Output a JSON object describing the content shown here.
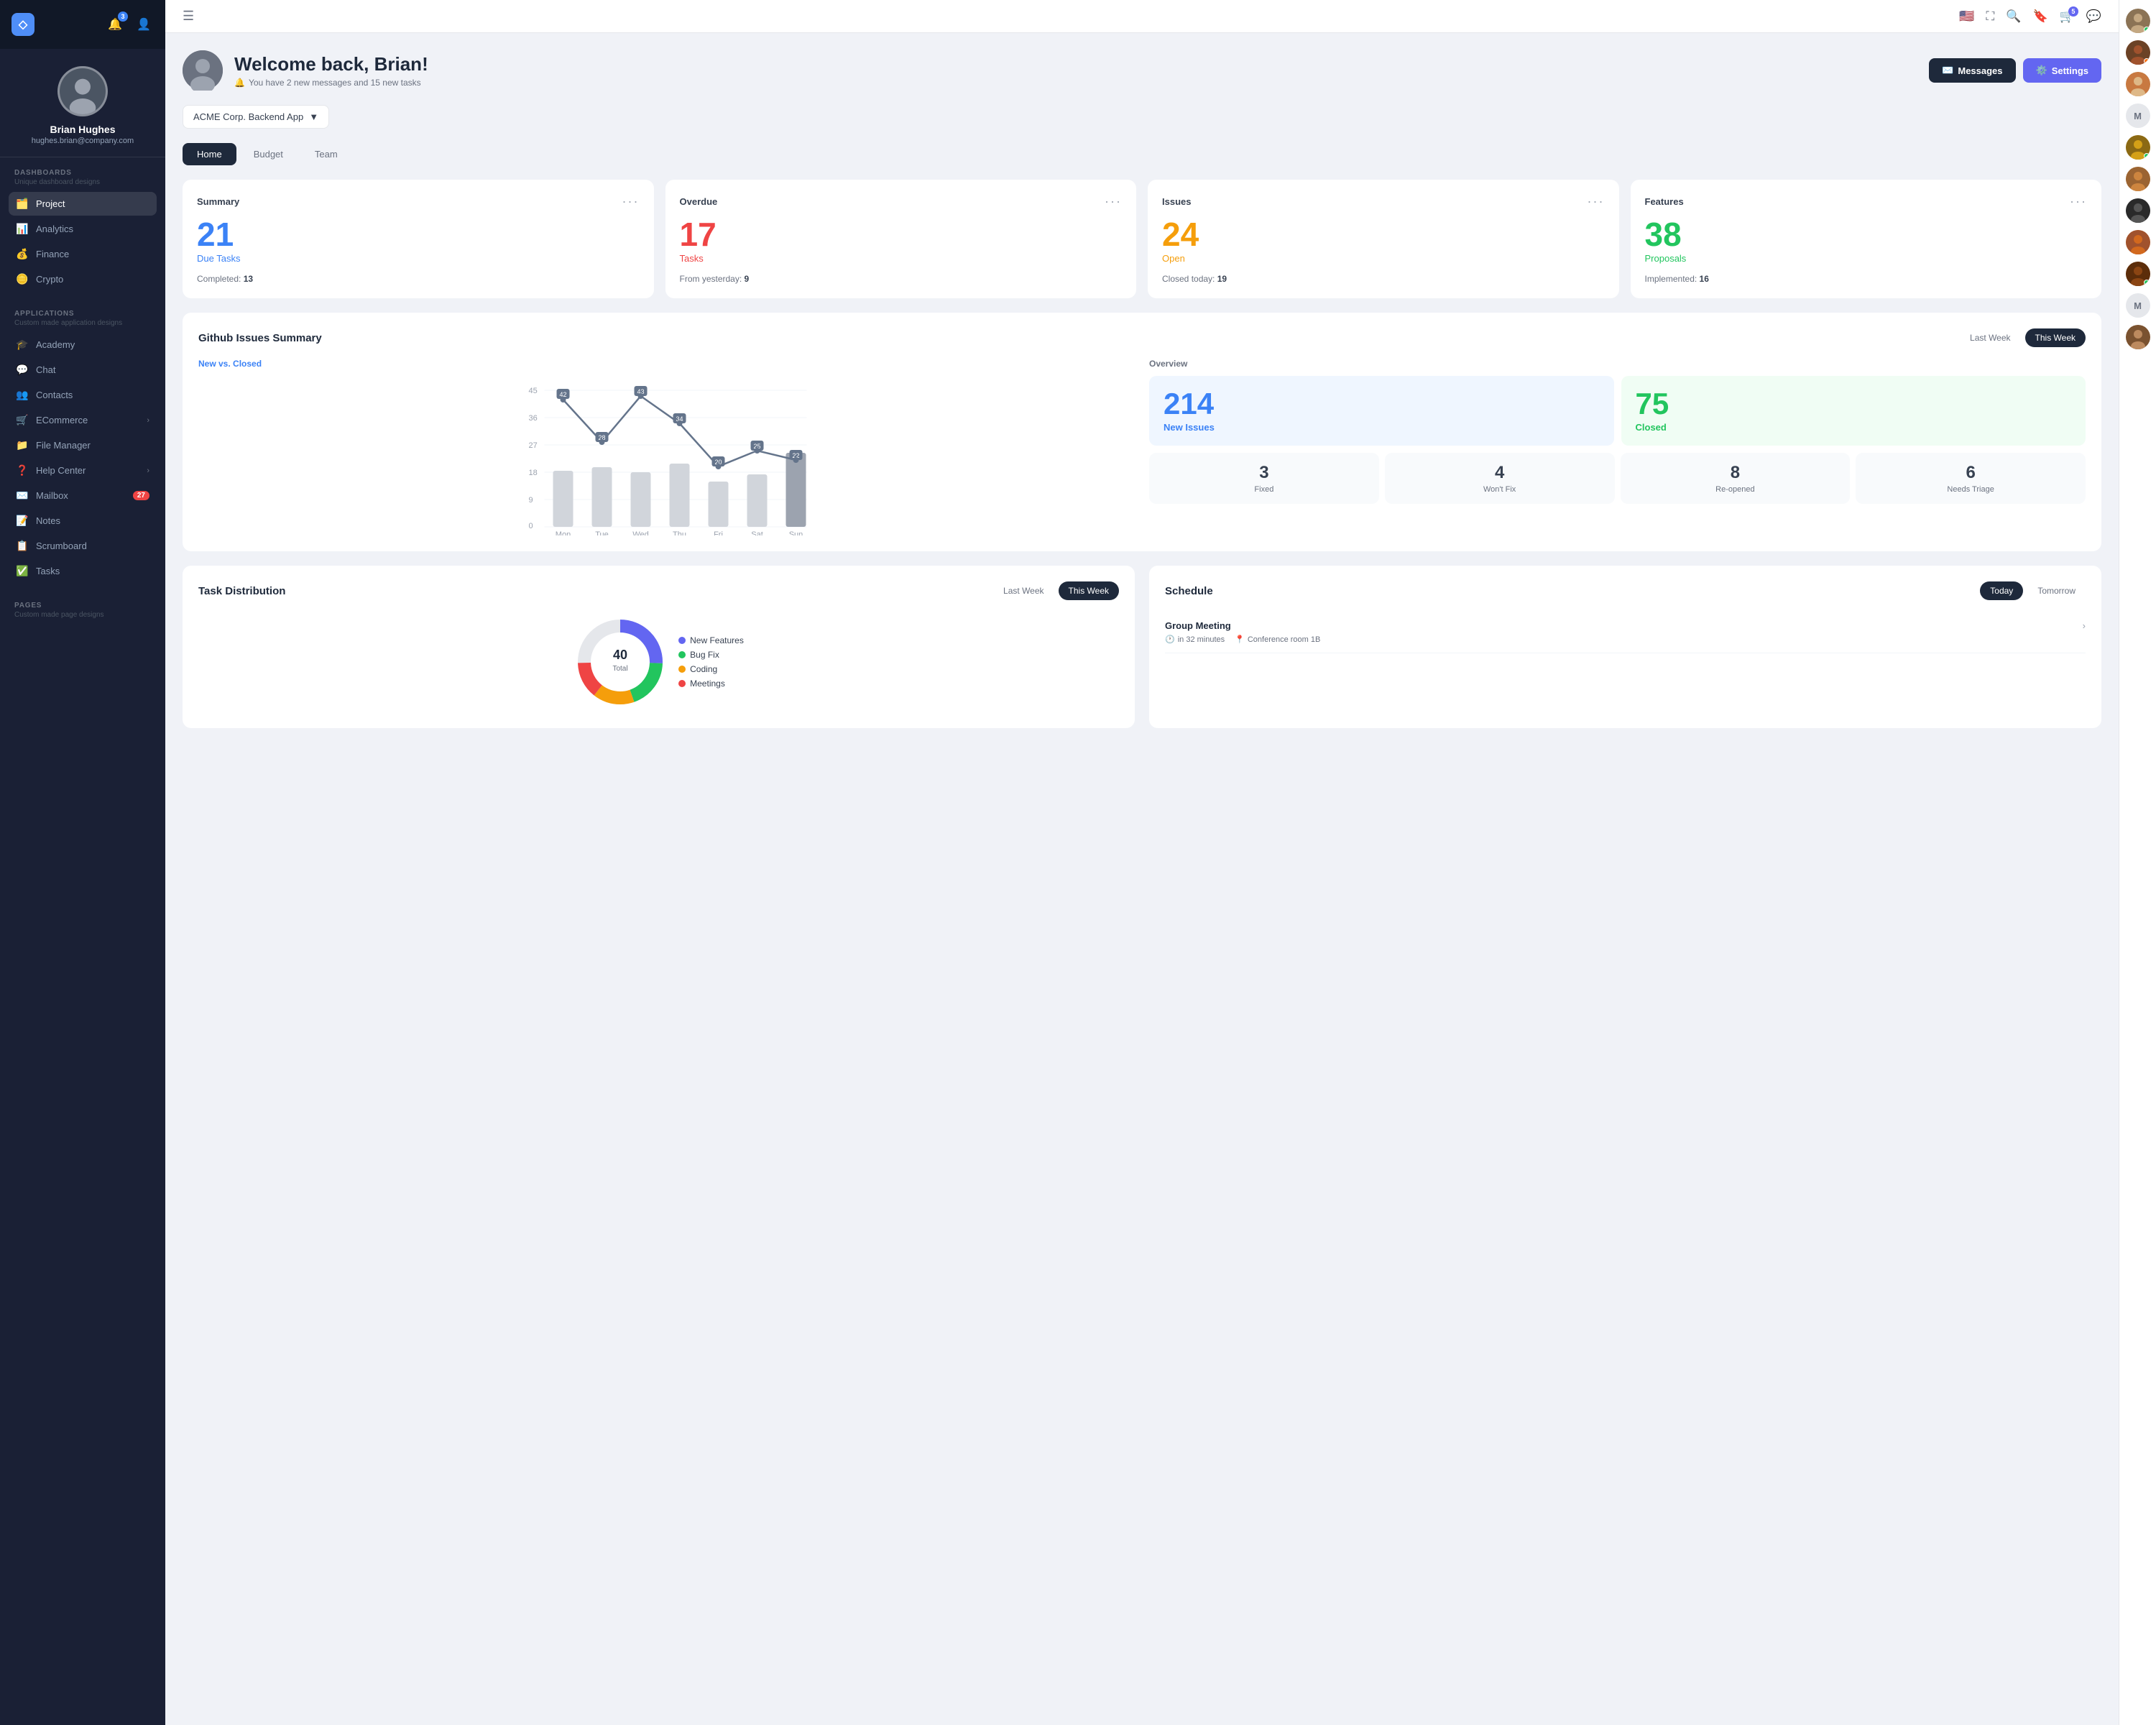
{
  "sidebar": {
    "logo": "◇",
    "notifications_badge": "3",
    "profile": {
      "name": "Brian Hughes",
      "email": "hughes.brian@company.com"
    },
    "dashboards_section": {
      "label": "DASHBOARDS",
      "sub": "Unique dashboard designs"
    },
    "dashboard_items": [
      {
        "icon": "🗂️",
        "label": "Project",
        "active": true
      },
      {
        "icon": "📊",
        "label": "Analytics"
      },
      {
        "icon": "💰",
        "label": "Finance"
      },
      {
        "icon": "🪙",
        "label": "Crypto"
      }
    ],
    "applications_section": {
      "label": "APPLICATIONS",
      "sub": "Custom made application designs"
    },
    "app_items": [
      {
        "icon": "🎓",
        "label": "Academy",
        "badge": null,
        "chevron": false
      },
      {
        "icon": "💬",
        "label": "Chat",
        "badge": null,
        "chevron": false
      },
      {
        "icon": "👥",
        "label": "Contacts",
        "badge": null,
        "chevron": false
      },
      {
        "icon": "🛒",
        "label": "ECommerce",
        "badge": null,
        "chevron": true
      },
      {
        "icon": "📁",
        "label": "File Manager",
        "badge": null,
        "chevron": false
      },
      {
        "icon": "❓",
        "label": "Help Center",
        "badge": null,
        "chevron": true
      },
      {
        "icon": "✉️",
        "label": "Mailbox",
        "badge": "27",
        "chevron": false
      },
      {
        "icon": "📝",
        "label": "Notes",
        "badge": null,
        "chevron": false
      },
      {
        "icon": "📋",
        "label": "Scrumboard",
        "badge": null,
        "chevron": false
      },
      {
        "icon": "✅",
        "label": "Tasks",
        "badge": null,
        "chevron": false
      }
    ],
    "pages_section": {
      "label": "PAGES",
      "sub": "Custom made page designs"
    }
  },
  "topbar": {
    "menu_icon": "☰",
    "flag": "🇺🇸",
    "fullscreen": "⛶",
    "search": "🔍",
    "bookmark": "🔖",
    "notifications": "🔔",
    "notifications_badge": "5",
    "chat": "💬"
  },
  "welcome": {
    "title": "Welcome back, Brian!",
    "subtitle": "You have 2 new messages and 15 new tasks",
    "bell_icon": "🔔",
    "messages_btn": "Messages",
    "settings_btn": "Settings"
  },
  "project_selector": {
    "label": "ACME Corp. Backend App",
    "chevron": "▼"
  },
  "tabs": [
    {
      "label": "Home",
      "active": true
    },
    {
      "label": "Budget",
      "active": false
    },
    {
      "label": "Team",
      "active": false
    }
  ],
  "stat_cards": [
    {
      "title": "Summary",
      "number": "21",
      "number_color": "blue",
      "label": "Due Tasks",
      "label_color": "blue",
      "footer_text": "Completed:",
      "footer_value": "13"
    },
    {
      "title": "Overdue",
      "number": "17",
      "number_color": "red",
      "label": "Tasks",
      "label_color": "red",
      "footer_text": "From yesterday:",
      "footer_value": "9"
    },
    {
      "title": "Issues",
      "number": "24",
      "number_color": "orange",
      "label": "Open",
      "label_color": "orange",
      "footer_text": "Closed today:",
      "footer_value": "19"
    },
    {
      "title": "Features",
      "number": "38",
      "number_color": "green",
      "label": "Proposals",
      "label_color": "green",
      "footer_text": "Implemented:",
      "footer_value": "16"
    }
  ],
  "github_issues": {
    "title": "Github Issues Summary",
    "period_last": "Last Week",
    "period_this": "This Week",
    "chart_label": "New vs. Closed",
    "chart_data": {
      "days": [
        "Mon",
        "Tue",
        "Wed",
        "Thu",
        "Fri",
        "Sat",
        "Sun"
      ],
      "line_values": [
        42,
        28,
        43,
        34,
        20,
        25,
        22
      ],
      "bar_heights": [
        70,
        75,
        68,
        80,
        55,
        65,
        95
      ]
    },
    "overview_label": "Overview",
    "new_issues": "214",
    "new_issues_label": "New Issues",
    "closed": "75",
    "closed_label": "Closed",
    "mini_cards": [
      {
        "num": "3",
        "label": "Fixed"
      },
      {
        "num": "4",
        "label": "Won't Fix"
      },
      {
        "num": "8",
        "label": "Re-opened"
      },
      {
        "num": "6",
        "label": "Needs Triage"
      }
    ]
  },
  "task_distribution": {
    "title": "Task Distribution",
    "period_last": "Last Week",
    "period_this": "This Week"
  },
  "schedule": {
    "title": "Schedule",
    "period_today": "Today",
    "period_tomorrow": "Tomorrow",
    "items": [
      {
        "name": "Group Meeting",
        "time": "in 32 minutes",
        "location": "Conference room 1B"
      }
    ]
  },
  "right_panel": {
    "avatars": [
      {
        "type": "image",
        "initial": "👤",
        "dot": "online"
      },
      {
        "type": "image",
        "initial": "👤",
        "dot": "orange"
      },
      {
        "type": "image",
        "initial": "👤",
        "dot": null
      },
      {
        "initial": "M",
        "dot": null
      },
      {
        "type": "image",
        "initial": "👤",
        "dot": "online"
      },
      {
        "type": "image",
        "initial": "👤",
        "dot": null
      },
      {
        "type": "image",
        "initial": "👤",
        "dot": null
      },
      {
        "type": "image",
        "initial": "👤",
        "dot": null
      },
      {
        "type": "image",
        "initial": "👤",
        "dot": "online"
      },
      {
        "initial": "M",
        "dot": null
      },
      {
        "type": "image",
        "initial": "👤",
        "dot": null
      }
    ]
  }
}
